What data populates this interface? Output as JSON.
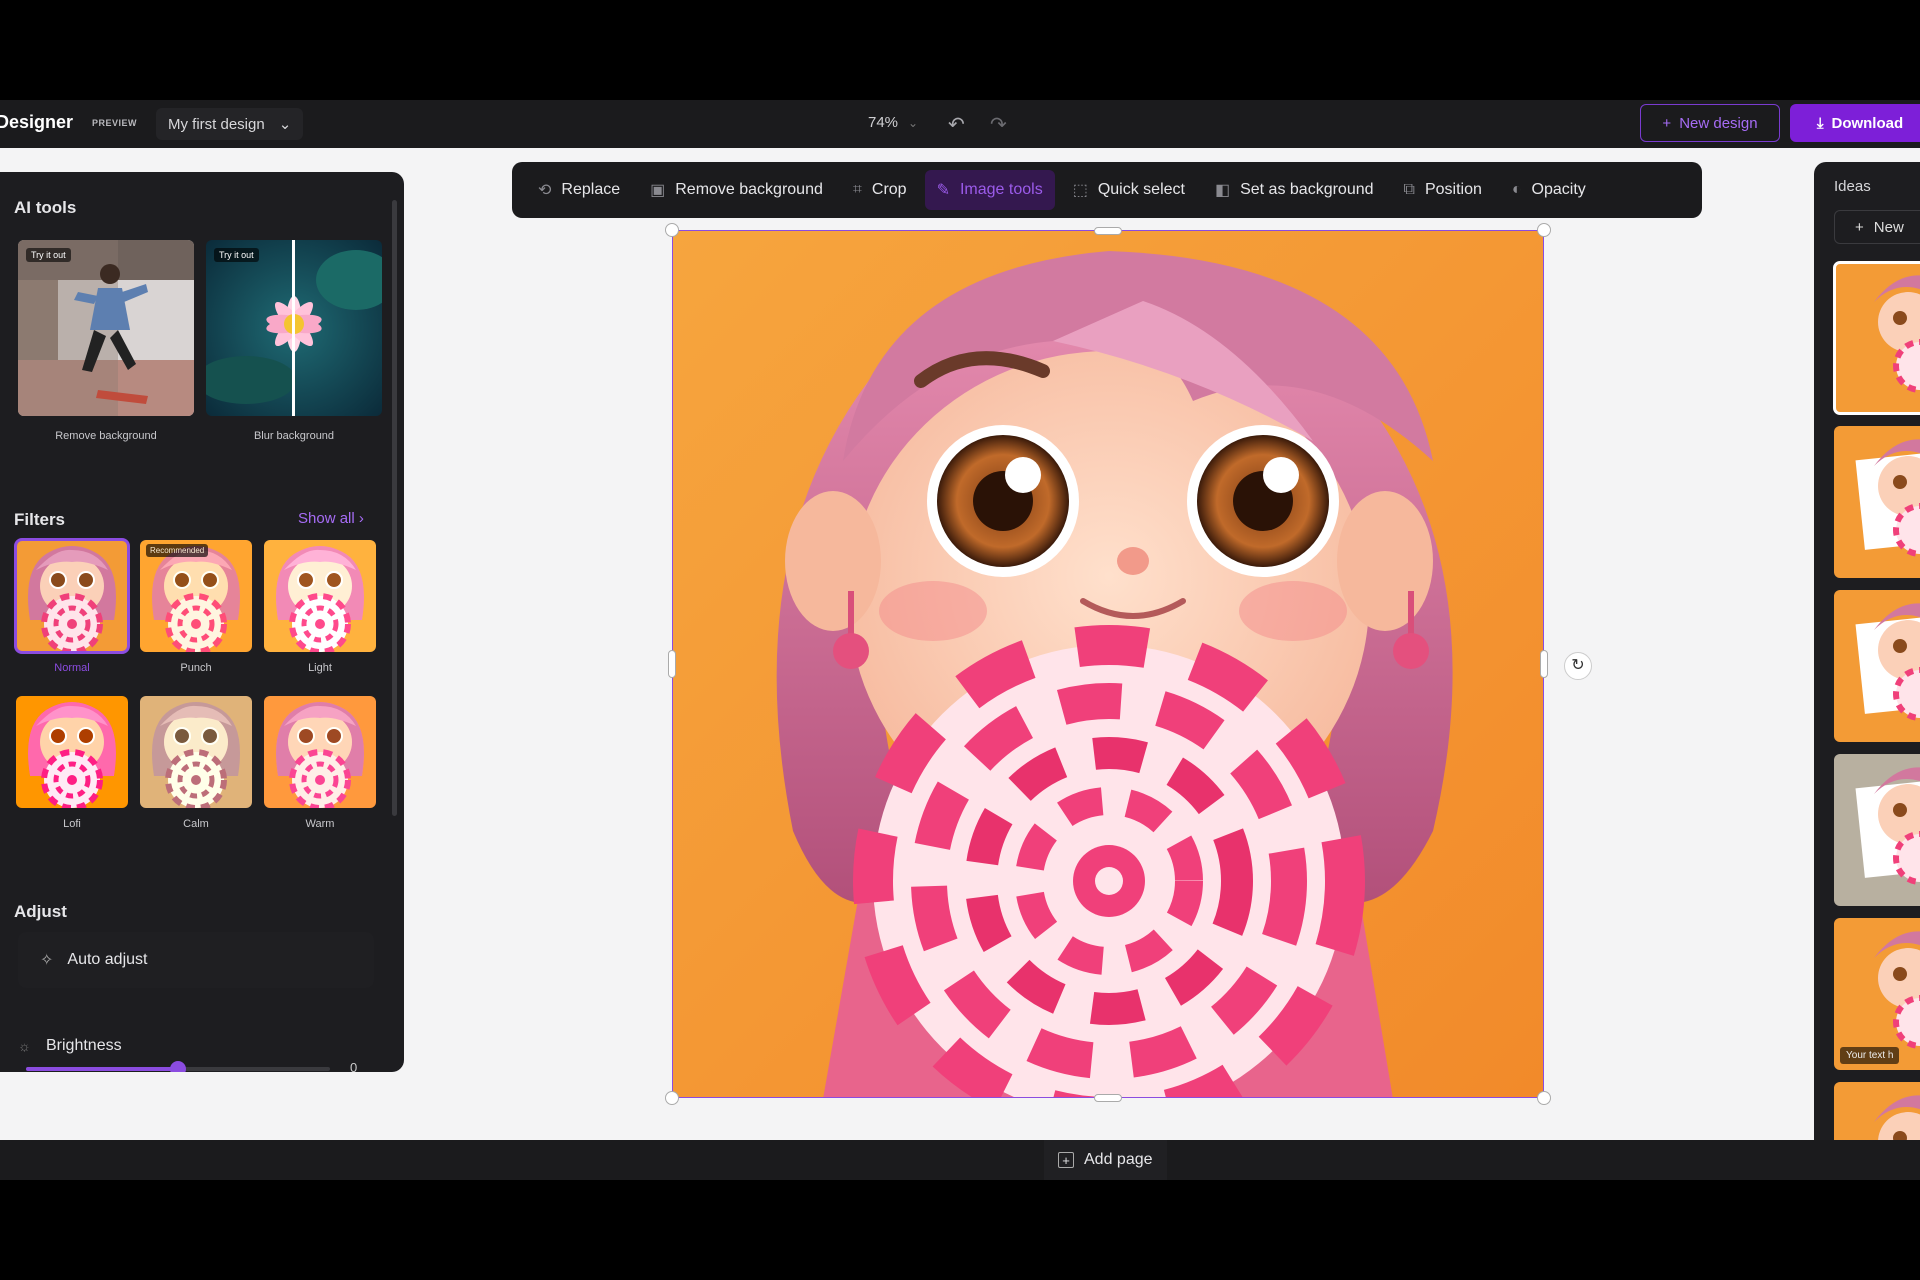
{
  "app": {
    "brand": "Designer",
    "preview_tag": "PREVIEW",
    "design_name": "My first design",
    "zoom": "74%",
    "new_design_label": "New design",
    "download_label": "Download"
  },
  "left_panel": {
    "ai_tools_title": "AI tools",
    "ai_tools": [
      {
        "badge": "Try it out",
        "label": "Remove background"
      },
      {
        "badge": "Try it out",
        "label": "Blur background"
      }
    ],
    "filters_title": "Filters",
    "show_all": "Show all",
    "recommended_badge": "Recommended",
    "filters": [
      {
        "label": "Normal",
        "selected": true
      },
      {
        "label": "Punch",
        "selected": false
      },
      {
        "label": "Light",
        "selected": false
      },
      {
        "label": "Lofi",
        "selected": false
      },
      {
        "label": "Calm",
        "selected": false
      },
      {
        "label": "Warm",
        "selected": false
      }
    ],
    "adjust_title": "Adjust",
    "auto_adjust": "Auto adjust",
    "brightness_label": "Brightness",
    "brightness_value": "0",
    "brightness_level": 0.5
  },
  "toolbar": {
    "items": [
      {
        "label": "Replace",
        "icon": "replace-icon"
      },
      {
        "label": "Remove background",
        "icon": "remove-background-icon"
      },
      {
        "label": "Crop",
        "icon": "crop-icon"
      },
      {
        "label": "Image tools",
        "icon": "image-tools-icon",
        "active": true
      },
      {
        "label": "Quick select",
        "icon": "quick-select-icon"
      },
      {
        "label": "Set as background",
        "icon": "set-background-icon"
      },
      {
        "label": "Position",
        "icon": "position-icon"
      },
      {
        "label": "Opacity",
        "icon": "opacity-icon"
      }
    ]
  },
  "right_panel": {
    "ideas_title": "Ideas",
    "new_label": "New",
    "idea_text": "Your text h"
  },
  "bottom": {
    "add_page": "Add page"
  },
  "colors": {
    "accent": "#7d1fd8",
    "accent_light": "#a66cf5",
    "panel_bg": "#1d1d20",
    "canvas_bg": "#f4f4f5"
  }
}
